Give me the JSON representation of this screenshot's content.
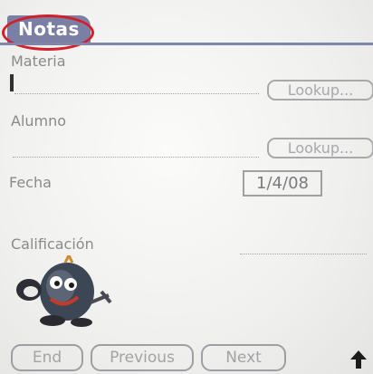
{
  "app": {
    "title": "Notas"
  },
  "form": {
    "materia_label": "Materia",
    "lookup_label": "Lookup...",
    "alumno_label": "Alumno",
    "fecha_label": "Fecha",
    "fecha_value": "1/4/08",
    "calificacion_label": "Calificación"
  },
  "nav": {
    "end_label": "End",
    "previous_label": "Previous",
    "next_label": "Next"
  },
  "icons": {
    "mascot": "cartoon-character-icon",
    "scroll": "up-arrow-icon",
    "highlight": "red-circle-annotation"
  },
  "colors": {
    "title_bar": "#7b7fa4",
    "annotation": "#d31f2a"
  }
}
